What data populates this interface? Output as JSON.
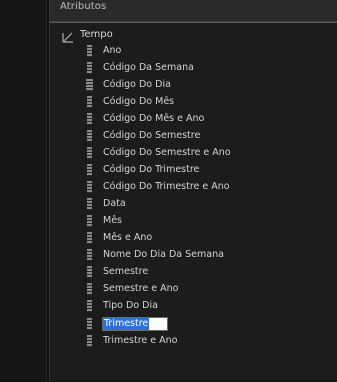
{
  "panel": {
    "title": "Atributos"
  },
  "tree": {
    "root": {
      "label": "Tempo",
      "icon": "hierarchy-icon"
    },
    "items": [
      {
        "label": "Ano",
        "icon": "attribute-icon"
      },
      {
        "label": "Código Da Semana",
        "icon": "attribute-icon"
      },
      {
        "label": "Código Do Dia",
        "icon": "key-attribute-icon"
      },
      {
        "label": "Código Do Mês",
        "icon": "attribute-icon"
      },
      {
        "label": "Código Do Mês e Ano",
        "icon": "attribute-icon"
      },
      {
        "label": "Código Do Semestre",
        "icon": "attribute-icon"
      },
      {
        "label": "Código Do Semestre e Ano",
        "icon": "attribute-icon"
      },
      {
        "label": "Código Do Trimestre",
        "icon": "attribute-icon"
      },
      {
        "label": "Código Do Trimestre e Ano",
        "icon": "attribute-icon"
      },
      {
        "label": "Data",
        "icon": "attribute-icon"
      },
      {
        "label": "Mês",
        "icon": "attribute-icon"
      },
      {
        "label": "Mês e Ano",
        "icon": "attribute-icon"
      },
      {
        "label": "Nome Do Dia Da Semana",
        "icon": "attribute-icon"
      },
      {
        "label": "Semestre",
        "icon": "attribute-icon"
      },
      {
        "label": "Semestre e Ano",
        "icon": "attribute-icon"
      },
      {
        "label": "Tipo Do Dia",
        "icon": "attribute-icon"
      },
      {
        "label": "Trimestre",
        "icon": "attribute-icon",
        "editing": true
      },
      {
        "label": "Trimestre e Ano",
        "icon": "attribute-icon"
      }
    ]
  },
  "colors": {
    "background": "#1c1c1c",
    "text": "#d4d4d4",
    "selection": "#2f6fd6"
  }
}
